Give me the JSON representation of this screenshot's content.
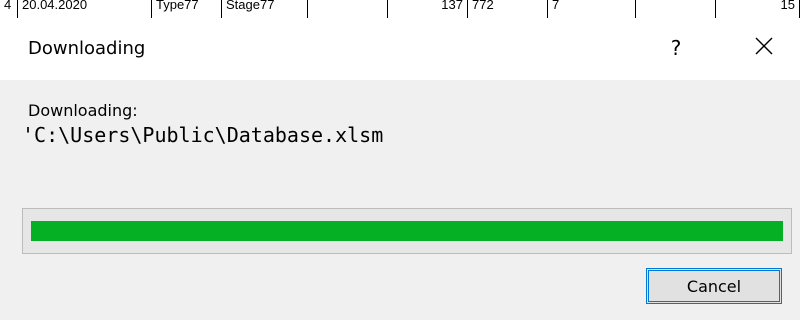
{
  "background_sheet": {
    "cells": [
      "4",
      "20.04.2020",
      "Type77",
      "Stage77",
      "",
      "137",
      "772",
      "7",
      "",
      "15"
    ]
  },
  "dialog": {
    "title": "Downloading",
    "help_label": "?",
    "close_icon": "close-icon",
    "caption": "Downloading:",
    "file_path": "'C:\\Users\\Public\\Database.xlsm",
    "progress": 1.0,
    "progress_color": "#06b025",
    "cancel_label": "Cancel"
  }
}
